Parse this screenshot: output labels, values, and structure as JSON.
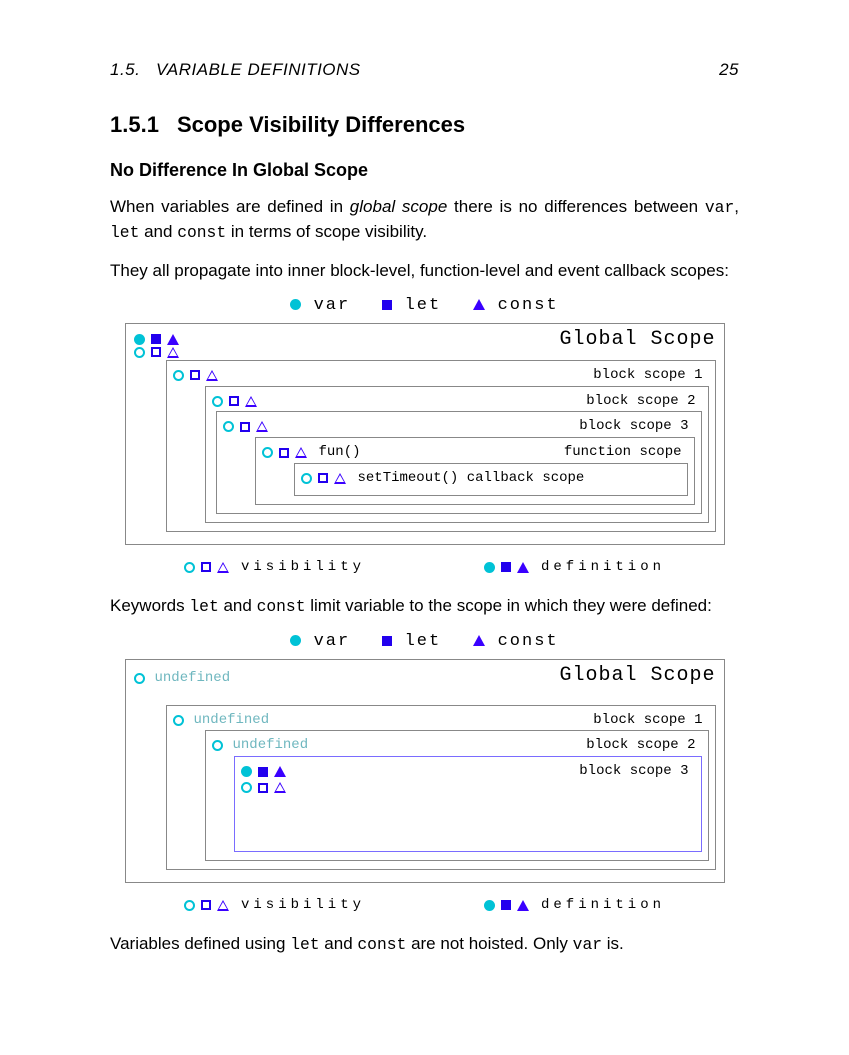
{
  "header": {
    "section_ref": "1.5.",
    "section_title": "VARIABLE DEFINITIONS",
    "page_number": "25"
  },
  "section": {
    "number": "1.5.1",
    "title": "Scope Visibility Differences"
  },
  "subhead": "No Difference In Global Scope",
  "para1": {
    "a": "When variables are defined in ",
    "term": "global scope",
    "b": " there is no differences between ",
    "c": ", ",
    "d": " and ",
    "e": " in terms of scope visibility."
  },
  "kw": {
    "var": "var",
    "let": "let",
    "const": "const"
  },
  "para2": "They all propagate into inner block-level, function-level and event callback scopes:",
  "diagram": {
    "legend": {
      "var": "var",
      "let": "let",
      "const": "const"
    },
    "global": "Global Scope",
    "b1": "block scope 1",
    "b2": "block scope 2",
    "b3": "block scope 3",
    "fun": "fun()",
    "funscope": "function scope",
    "cb": "setTimeout() callback scope",
    "vis": "visibility",
    "def": "definition",
    "undef": "undefined"
  },
  "para3": {
    "a": "Keywords ",
    "b": " and ",
    "c": " limit variable to the scope in which they were defined:"
  },
  "para4": {
    "a": "Variables defined using ",
    "b": " and ",
    "c": " are not hoisted. Only ",
    "d": " is."
  },
  "chart_data": [
    {
      "type": "table",
      "title": "Scope visibility — var/let/const defined in global scope",
      "legend": [
        {
          "shape": "circle",
          "color": "#00c2d6",
          "name": "var"
        },
        {
          "shape": "square",
          "color": "#2200ee",
          "name": "let"
        },
        {
          "shape": "triangle",
          "color": "#3a00ff",
          "name": "const"
        }
      ],
      "shape_meaning": {
        "outline": "visibility",
        "filled": "definition"
      },
      "rows": [
        {
          "scope": "Global Scope",
          "var": "defined+visible",
          "let": "defined+visible",
          "const": "defined+visible"
        },
        {
          "scope": "block scope 1",
          "var": "visible",
          "let": "visible",
          "const": "visible"
        },
        {
          "scope": "block scope 2",
          "var": "visible",
          "let": "visible",
          "const": "visible"
        },
        {
          "scope": "block scope 3",
          "var": "visible",
          "let": "visible",
          "const": "visible"
        },
        {
          "scope": "fun() function scope",
          "var": "visible",
          "let": "visible",
          "const": "visible"
        },
        {
          "scope": "setTimeout() callback scope",
          "var": "visible",
          "let": "visible",
          "const": "visible"
        }
      ]
    },
    {
      "type": "table",
      "title": "Scope visibility — let/const defined in block scope 3",
      "legend": [
        {
          "shape": "circle",
          "color": "#00c2d6",
          "name": "var"
        },
        {
          "shape": "square",
          "color": "#2200ee",
          "name": "let"
        },
        {
          "shape": "triangle",
          "color": "#3a00ff",
          "name": "const"
        }
      ],
      "shape_meaning": {
        "outline": "visibility",
        "filled": "definition"
      },
      "rows": [
        {
          "scope": "Global Scope",
          "var": "undefined",
          "let": "none",
          "const": "none"
        },
        {
          "scope": "block scope 1",
          "var": "undefined",
          "let": "none",
          "const": "none"
        },
        {
          "scope": "block scope 2",
          "var": "undefined",
          "let": "none",
          "const": "none"
        },
        {
          "scope": "block scope 3",
          "var": "defined+visible",
          "let": "defined+visible",
          "const": "defined+visible"
        }
      ]
    }
  ]
}
